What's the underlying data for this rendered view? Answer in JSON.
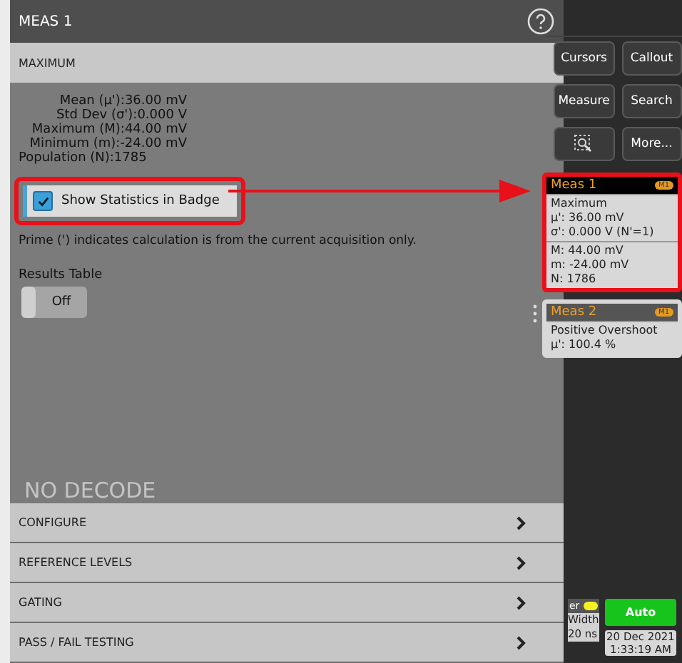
{
  "panel": {
    "title": "MEAS 1",
    "measurement": "MAXIMUM",
    "statistics": [
      "Mean (µ'):36.00 mV",
      "Std Dev (σ'):0.000 V",
      "Maximum (M):44.00 mV",
      "Minimum (m):-24.00 mV"
    ],
    "population": "Population (N):1785",
    "badge_checkbox": {
      "label": "Show Statistics in Badge",
      "checked": true,
      "highlighted": true
    },
    "note": "Prime (') indicates calculation is from the current acquisition only.",
    "results_table": {
      "label": "Results Table",
      "value": "Off",
      "on": false
    },
    "background_text": "NO DECODE",
    "sections": [
      "CONFIGURE",
      "REFERENCE LEVELS",
      "GATING",
      "PASS / FAIL TESTING"
    ]
  },
  "toolbar": {
    "buttons": [
      {
        "kind": "text",
        "label": "Cursors"
      },
      {
        "kind": "text",
        "label": "Callout"
      },
      {
        "kind": "text",
        "label": "Measure"
      },
      {
        "kind": "text",
        "label": "Search"
      },
      {
        "kind": "zoom"
      },
      {
        "kind": "text",
        "label": "More..."
      }
    ]
  },
  "badges": [
    {
      "title": "Meas 1",
      "source": "M1",
      "highlighted": true,
      "groups": [
        [
          "Maximum",
          "µ': 36.00 mV",
          "σ': 0.000 V (N'=1)"
        ],
        [
          "M: 44.00 mV",
          "m: -24.00 mV",
          "N: 1786"
        ]
      ]
    },
    {
      "title": "Meas 2",
      "source": "M1",
      "highlighted": false,
      "groups": [
        [
          "Positive Overshoot",
          "µ': 100.4 %"
        ]
      ]
    }
  ],
  "trigger": {
    "title": "er",
    "detail": [
      "Width",
      "20 ns"
    ]
  },
  "acquisition": {
    "mode": "Auto",
    "date": "20 Dec 2021",
    "time": "1:33:19 AM"
  }
}
